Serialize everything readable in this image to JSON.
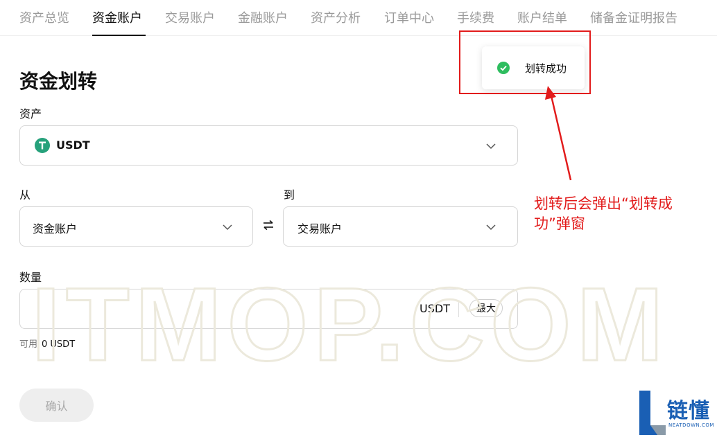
{
  "nav": {
    "tabs": [
      {
        "label": "资产总览",
        "active": false
      },
      {
        "label": "资金账户",
        "active": true
      },
      {
        "label": "交易账户",
        "active": false
      },
      {
        "label": "金融账户",
        "active": false
      },
      {
        "label": "资产分析",
        "active": false
      },
      {
        "label": "订单中心",
        "active": false
      },
      {
        "label": "手续费",
        "active": false
      },
      {
        "label": "账户结单",
        "active": false
      },
      {
        "label": "储备金证明报告",
        "active": false
      }
    ]
  },
  "transfer": {
    "title": "资金划转",
    "asset_label": "资产",
    "asset_value": "USDT",
    "asset_icon": "tether-icon",
    "from_label": "从",
    "from_value": "资金账户",
    "to_label": "到",
    "to_value": "交易账户",
    "swap_icon": "swap-arrows-icon",
    "amount_label": "数量",
    "amount_value": "",
    "amount_unit": "USDT",
    "max_label": "最大",
    "available_label": "可用",
    "available_value": "0 USDT",
    "confirm_label": "确认"
  },
  "toast": {
    "message": "划转成功",
    "icon": "check-circle-icon",
    "color": "#2ebd5f"
  },
  "annotation": {
    "text": "划转后会弹出“划转成功”弹窗",
    "color": "#e21b1b"
  },
  "watermark": {
    "text": "ITMOP.COM"
  },
  "brand": {
    "cn": "链懂",
    "en": "NEATDOWN.COM"
  }
}
